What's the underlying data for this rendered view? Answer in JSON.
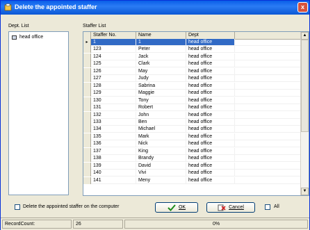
{
  "window": {
    "title": "Delete the appointed staffer",
    "close_label": "x"
  },
  "dept_list": {
    "label": "Dept. List",
    "items": [
      "head office"
    ]
  },
  "staffer_list": {
    "label": "Staffer List",
    "columns": [
      "Staffer No.",
      "Name",
      "Dept"
    ],
    "rows": [
      [
        "1",
        "1",
        "head office"
      ],
      [
        "123",
        "Peter",
        "head office"
      ],
      [
        "124",
        "Jack",
        "head office"
      ],
      [
        "125",
        "Clark",
        "head office"
      ],
      [
        "126",
        "May",
        "head office"
      ],
      [
        "127",
        "Judy",
        "head office"
      ],
      [
        "128",
        "Sabrina",
        "head office"
      ],
      [
        "129",
        "Maggie",
        "head office"
      ],
      [
        "130",
        "Tony",
        "head office"
      ],
      [
        "131",
        "Robert",
        "head office"
      ],
      [
        "132",
        "John",
        "head office"
      ],
      [
        "133",
        "Ben",
        "head office"
      ],
      [
        "134",
        "Michael",
        "head office"
      ],
      [
        "135",
        "Mark",
        "head office"
      ],
      [
        "136",
        "Nick",
        "head office"
      ],
      [
        "137",
        "King",
        "head office"
      ],
      [
        "138",
        "Brandy",
        "head office"
      ],
      [
        "139",
        "David",
        "head office"
      ],
      [
        "140",
        "Vivi",
        "head office"
      ],
      [
        "141",
        "Meny",
        "head office"
      ]
    ],
    "selected_row_marker": "▸"
  },
  "options": {
    "delete_on_computer_label": "Delete the appointed staffer on the computer",
    "ok_label": "OK",
    "cancel_label": "Cancel",
    "all_label": "All"
  },
  "status": {
    "record_count_label": "RecordCount:",
    "record_count": "26",
    "progress": "0%"
  },
  "colors": {
    "titlebar": "#0a5ee8",
    "selection": "#316ac5"
  }
}
